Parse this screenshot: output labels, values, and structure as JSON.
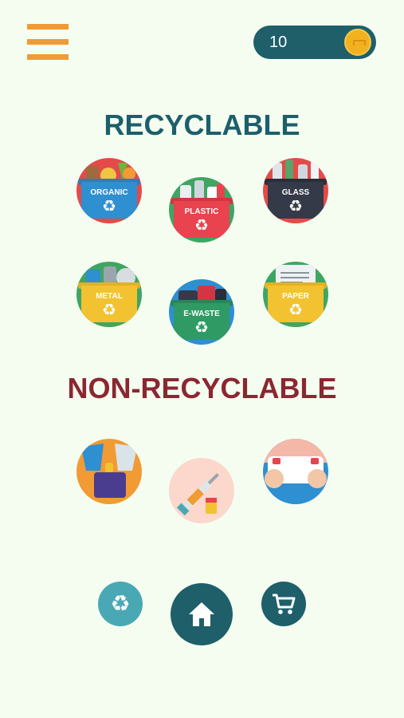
{
  "header": {
    "coin_count": "10"
  },
  "sections": {
    "recyclable_title": "RECYCLABLE",
    "non_recyclable_title": "NON-RECYCLABLE"
  },
  "bins": [
    {
      "label": "ORGANIC",
      "color": "#2e8fd1"
    },
    {
      "label": "PLASTIC",
      "color": "#e8434f"
    },
    {
      "label": "GLASS",
      "color": "#353a48"
    },
    {
      "label": "METAL",
      "color": "#f2c230"
    },
    {
      "label": "E-WASTE",
      "color": "#2f9a63"
    },
    {
      "label": "PAPER",
      "color": "#f2c230"
    }
  ],
  "non_recyclable": [
    {
      "icon": "clothes-icon"
    },
    {
      "icon": "syringe-icon"
    },
    {
      "icon": "diaper-icon"
    }
  ],
  "nav": {
    "recycle_icon": "recycle-icon",
    "home_icon": "home-icon",
    "cart_icon": "cart-icon"
  },
  "colors": {
    "accent_orange": "#f29a33",
    "teal_dark": "#1e5f6a",
    "teal_light": "#4aa8b5",
    "heading_red": "#8b2730",
    "background": "#f5fdf1"
  }
}
